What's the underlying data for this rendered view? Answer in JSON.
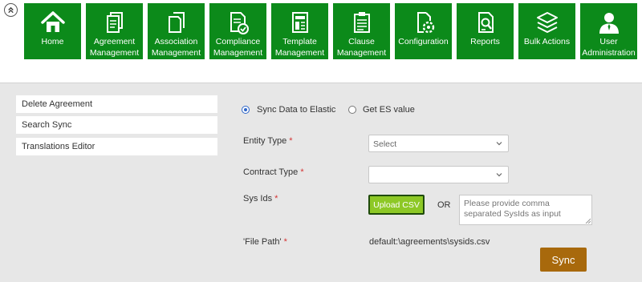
{
  "nav": {
    "items": [
      {
        "label": "Home",
        "icon": "home-icon"
      },
      {
        "label": "Agreement\nManagement",
        "icon": "agreement-document-icon"
      },
      {
        "label": "Association\nManagement",
        "icon": "documents-icon"
      },
      {
        "label": "Compliance\nManagement",
        "icon": "compliance-document-icon"
      },
      {
        "label": "Template\nManagement",
        "icon": "template-icon"
      },
      {
        "label": "Clause\nManagement",
        "icon": "clipboard-icon"
      },
      {
        "label": "Configuration",
        "icon": "configuration-icon"
      },
      {
        "label": "Reports",
        "icon": "report-search-icon"
      },
      {
        "label": "Bulk Actions",
        "icon": "layers-icon"
      },
      {
        "label": "User\nAdministration",
        "icon": "user-icon"
      }
    ]
  },
  "sidebar": {
    "items": [
      {
        "label": "Delete Agreement"
      },
      {
        "label": "Search Sync"
      },
      {
        "label": "Translations Editor"
      }
    ]
  },
  "form": {
    "mode_options": [
      {
        "label": "Sync Data to Elastic",
        "selected": true
      },
      {
        "label": "Get ES value",
        "selected": false
      }
    ],
    "entity_type": {
      "label": "Entity Type",
      "required_mark": "*",
      "value": "Select"
    },
    "contract_type": {
      "label": "Contract Type",
      "required_mark": "*",
      "value": ""
    },
    "sys_ids": {
      "label": "Sys Ids",
      "required_mark": "*",
      "upload_label": "Upload CSV",
      "or_label": "OR",
      "placeholder": "Please provide comma separated SysIds as input"
    },
    "file_path": {
      "label": "'File Path'",
      "required_mark": "*",
      "value": "default:\\agreements\\sysids.csv"
    },
    "sync_label": "Sync"
  },
  "colors": {
    "nav_green": "#0c8a1a",
    "upload_green": "#8dc826",
    "sync_brown": "#a8690c",
    "required_red": "#d43333",
    "radio_blue": "#2e66c8"
  }
}
